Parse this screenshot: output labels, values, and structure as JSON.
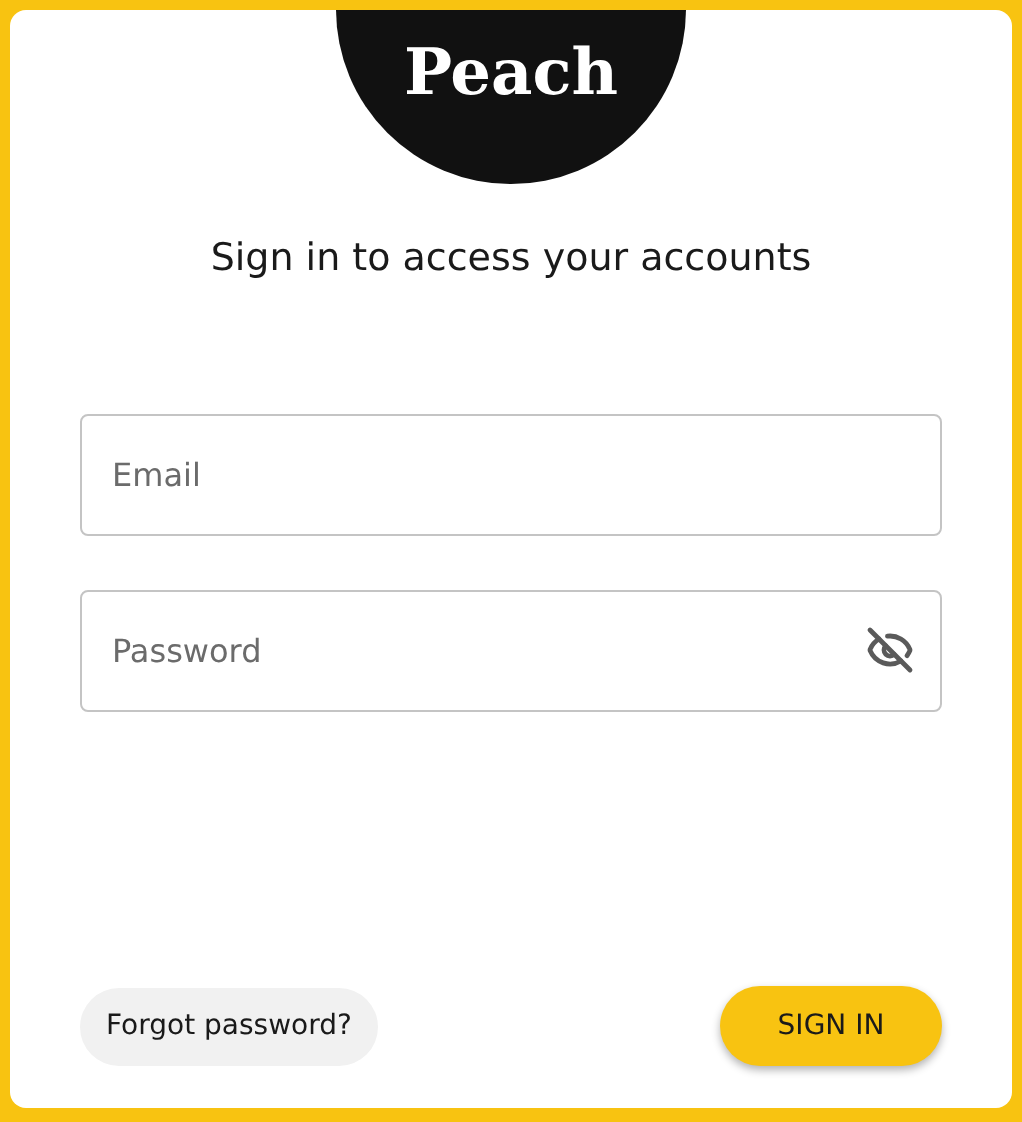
{
  "logo": "Peach",
  "heading": "Sign in to access your accounts",
  "fields": [
    {
      "kind": "email",
      "placeholder": "Email"
    },
    {
      "kind": "password",
      "placeholder": "Password"
    }
  ],
  "forgot_link": "Forgot password?",
  "submit_button": "SIGN IN"
}
